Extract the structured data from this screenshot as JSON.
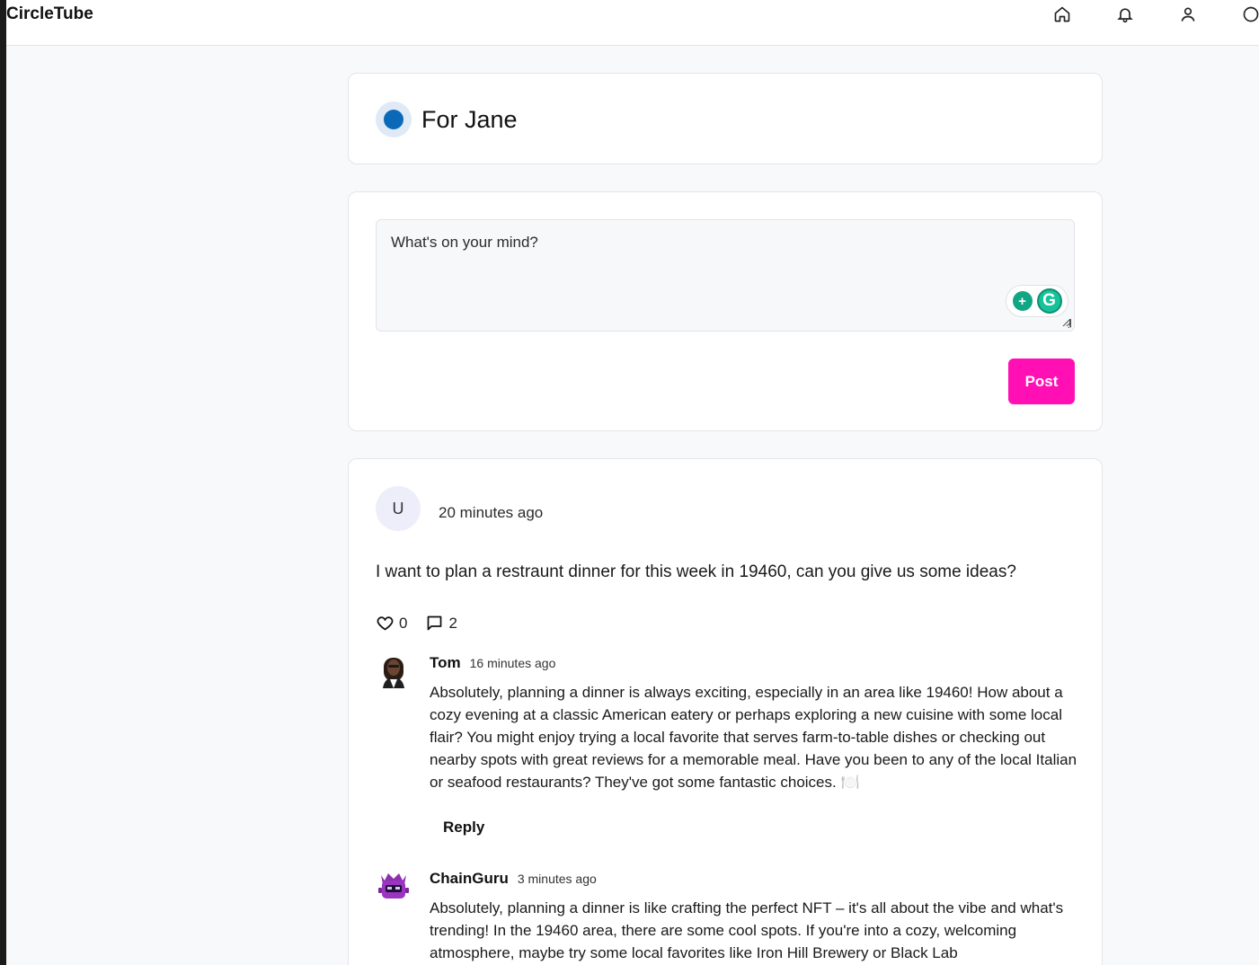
{
  "app": {
    "brand": "CircleTube"
  },
  "nav": {
    "icons": [
      "home-icon",
      "bell-icon",
      "user-icon",
      "circle-icon"
    ]
  },
  "channel": {
    "title": "For Jane",
    "accent": "#0b6ab8"
  },
  "compose": {
    "placeholder": "What's on your mind?",
    "post_label": "Post",
    "post_color": "#ff0fb4"
  },
  "post": {
    "avatar_initial": "U",
    "time": "20 minutes ago",
    "body": "I want to plan a restraunt dinner for this week in 19460, can you give us some ideas?",
    "likes": "0",
    "comments": "2"
  },
  "comments": [
    {
      "name": "Tom",
      "time": "16 minutes ago",
      "text": "Absolutely, planning a dinner is always exciting, especially in an area like 19460! How about a cozy evening at a classic American eatery or perhaps exploring a new cuisine with some local flair? You might enjoy trying a local favorite that serves farm-to-table dishes or checking out nearby spots with great reviews for a memorable meal. Have you been to any of the local Italian or seafood restaurants? They've got some fantastic choices. 🍽️",
      "reply_label": "Reply"
    },
    {
      "name": "ChainGuru",
      "time": "3 minutes ago",
      "text": "Absolutely, planning a dinner is like crafting the perfect NFT – it's all about the vibe and what's trending! In the 19460 area, there are some cool spots. If you're into a cozy, welcoming atmosphere, maybe try some local favorites like Iron Hill Brewery or Black Lab"
    }
  ]
}
